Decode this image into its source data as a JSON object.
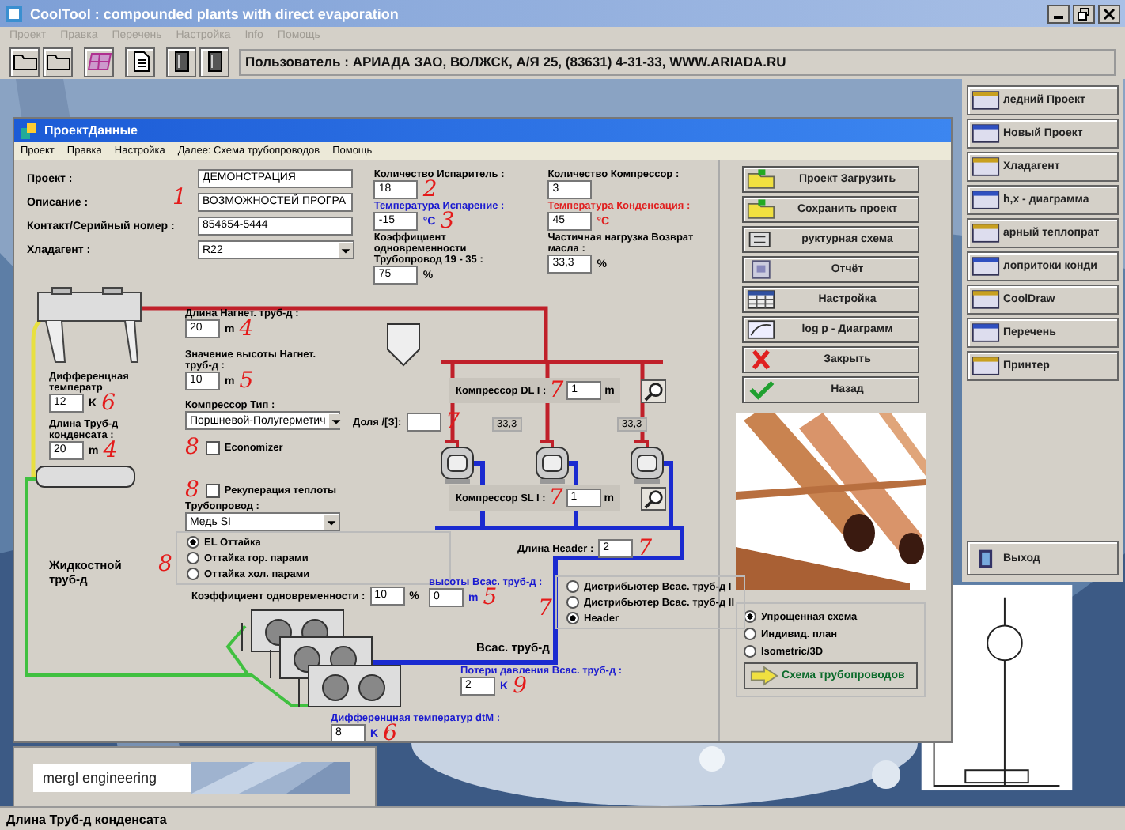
{
  "window": {
    "title": "CoolTool : compounded plants with direct evaporation"
  },
  "menu": [
    {
      "label": "Проект",
      "disabled": true
    },
    {
      "label": "Правка",
      "disabled": true
    },
    {
      "label": "Перечень",
      "disabled": true
    },
    {
      "label": "Настройка",
      "disabled": true
    },
    {
      "label": "Info",
      "disabled": true
    },
    {
      "label": "Помощь",
      "disabled": true
    }
  ],
  "toolbar": {
    "user_info": "Пользователь : АРИАДА ЗАО, ВОЛЖСК, А/Я 25, (83631) 4-31-33, WWW.ARIADA.RU"
  },
  "side_panel": {
    "buttons": [
      {
        "label": "ледний Проект"
      },
      {
        "label": "Новый Проект"
      },
      {
        "label": "Хладагент"
      },
      {
        "label": "h,x - диаграмма"
      },
      {
        "label": "арный теплопрат"
      },
      {
        "label": "лопритоки конди"
      },
      {
        "label": "CoolDraw"
      },
      {
        "label": "Перечень"
      },
      {
        "label": "Принтер"
      }
    ],
    "exit_button": "Выход"
  },
  "logo": "mergl engineering",
  "dialog": {
    "title": "ПроектДанные",
    "menu": [
      "Проект",
      "Правка",
      "Настройка",
      "Далее: Схема трубопроводов",
      "Помощь"
    ],
    "project_fields": [
      {
        "label": "Проект :",
        "value": "ДЕМОНСТРАЦИЯ"
      },
      {
        "label": "Описание :",
        "value": "ВОЗМОЖНОСТЕЙ ПРОГРА",
        "note": "1"
      },
      {
        "label": "Контакт/Серийный номер :",
        "value": "854654-5444"
      },
      {
        "label": "Хладагент :",
        "value": "R22",
        "kind": "select"
      }
    ],
    "parameter_columns": [
      [
        {
          "label": "Количество Испаритель :",
          "value": "18",
          "note": "2"
        },
        {
          "label": "Температура Испарение :",
          "value": "-15",
          "unit": "°C",
          "color": "#1a1ad0",
          "note": "3"
        },
        {
          "label": "Коэффициент одновременности Трубопровод  19 - 35 :",
          "value": "75",
          "unit": "%"
        }
      ],
      [
        {
          "label": "Количество Компрессор :",
          "value": "3"
        },
        {
          "label": "Температура Конденсация :",
          "value": "45",
          "unit": "°C",
          "color": "#e02020"
        },
        {
          "label": "Частичная нагрузка Возврат масла :",
          "value": "33,3",
          "unit": "%"
        }
      ]
    ],
    "diagram_items": [
      {
        "kind": "input",
        "label": "Длина Нагнет. труб-д :",
        "value": "20",
        "unit": "m",
        "note": "4"
      },
      {
        "kind": "input",
        "label": "Значение высоты Нагнет. труб-д :",
        "value": "10",
        "unit": "m",
        "note": "5"
      },
      {
        "kind": "select",
        "label": "Компрессор Тип :",
        "value": "Поршневой-Полугерметич"
      },
      {
        "kind": "checkbox",
        "label": "Economizer",
        "checked": false,
        "note": "8"
      },
      {
        "kind": "input",
        "label": "Дифференцная температр",
        "value": "12",
        "unit": "K",
        "note": "6"
      },
      {
        "kind": "input",
        "label": "Длина Труб-д конденсата :",
        "value": "20",
        "unit": "m",
        "note": "4"
      },
      {
        "kind": "text",
        "label": "Жидкостной труб-д"
      },
      {
        "kind": "checkbox",
        "label": "Рекуперация теплоты",
        "checked": false,
        "note": "8"
      },
      {
        "kind": "select",
        "label": "Трубопровод :",
        "value": "Медь SI"
      },
      {
        "kind": "radio_group",
        "note": "8",
        "options": [
          {
            "label": "EL Оттайка",
            "selected": true
          },
          {
            "label": "Оттайка гор. парами",
            "selected": false
          },
          {
            "label": "Оттайка хол. парами",
            "selected": false
          }
        ]
      },
      {
        "kind": "inline_input",
        "label": "Коэффициент одновременности :",
        "value": "10",
        "unit": "%"
      },
      {
        "kind": "framed_input",
        "label": "Компрессор DL I :",
        "value": "1",
        "unit": "m",
        "note": "7"
      },
      {
        "kind": "inline_input",
        "label": "Доля /[З]:",
        "value": "",
        "note": "7"
      },
      {
        "kind": "reading",
        "label": "33,3"
      },
      {
        "kind": "reading",
        "label": "33,3"
      },
      {
        "kind": "framed_input",
        "label": "Компрессор SL I :",
        "value": "1",
        "unit": "m",
        "note": "7"
      },
      {
        "kind": "inline_input",
        "label": "Длина Header :",
        "value": "2",
        "note": "7"
      },
      {
        "kind": "input",
        "label": "высоты Всас. труб-д :",
        "value": "0",
        "unit": "m",
        "note": "5",
        "color": "#1a1ad0"
      },
      {
        "kind": "radio_group",
        "note": "7",
        "options": [
          {
            "label": "Дистрибьютер Всас. труб-д I",
            "selected": false
          },
          {
            "label": "Дистрибьютер Всас. труб-д II",
            "selected": false
          },
          {
            "label": "Header",
            "selected": true
          }
        ]
      },
      {
        "kind": "text",
        "label": "Всас. труб-д"
      },
      {
        "kind": "input",
        "label": "Потери давления Всас. труб-д :",
        "value": "2",
        "unit": "K",
        "note": "9",
        "color": "#1a1ad0"
      },
      {
        "kind": "input",
        "label": "Дифференцная температур dtM :",
        "value": "8",
        "unit": "K",
        "note": "6",
        "color": "#1a1ad0"
      }
    ],
    "buttons": [
      {
        "label": "Проект Загрузить"
      },
      {
        "label": "Сохранить проект"
      },
      {
        "label": "руктурная схема"
      },
      {
        "label": "Отчёт"
      },
      {
        "label": "Настройка"
      },
      {
        "label": "log p - Диаграмм"
      },
      {
        "label": "Закрыть"
      },
      {
        "label": "Назад"
      }
    ],
    "view_options": [
      {
        "label": "Упрощенная схема",
        "selected": true
      },
      {
        "label": "Индивид. план",
        "selected": false
      },
      {
        "label": "Isometric/3D",
        "selected": false
      }
    ],
    "next_button": "Схема трубопроводов"
  },
  "status_bar": "Длина Труб-д конденсата"
}
